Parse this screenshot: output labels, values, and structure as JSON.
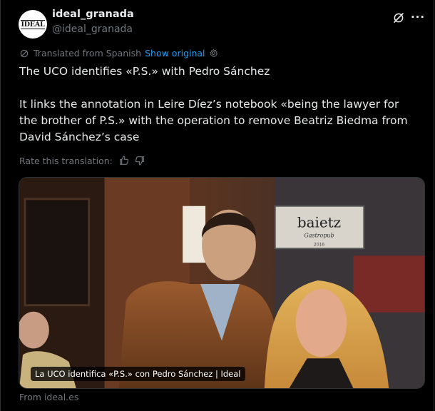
{
  "author": {
    "avatar_text": "IDEAL",
    "display_name": "ideal_granada",
    "handle": "@ideal_granada"
  },
  "translation": {
    "notice": "Translated from Spanish",
    "show_original": "Show original"
  },
  "tweet": {
    "line1": "The UCO identifies «P.S.» with Pedro Sánchez",
    "line2": "It links the annotation in Leire Díez’s notebook «being the lawyer for the brother of P.S.» with the operation to remove Beatriz Biedma from David Sánchez’s case"
  },
  "rate": {
    "label": "Rate this translation:"
  },
  "media": {
    "sign_text": "baietz",
    "sign_sub": "Gastropub",
    "sign_year": "2016",
    "caption": "La UCO identifica «P.S.» con Pedro Sánchez | Ideal"
  },
  "link_source": "From ideal.es",
  "icons": [
    "grok-icon",
    "more-icon",
    "translate-icon",
    "gear-icon",
    "thumbs-up-icon",
    "thumbs-down-icon"
  ],
  "colors": {
    "background": "#000000",
    "text": "#e7e9ea",
    "muted": "#71767b",
    "accent": "#1d9bf0",
    "border": "#2f3336"
  }
}
